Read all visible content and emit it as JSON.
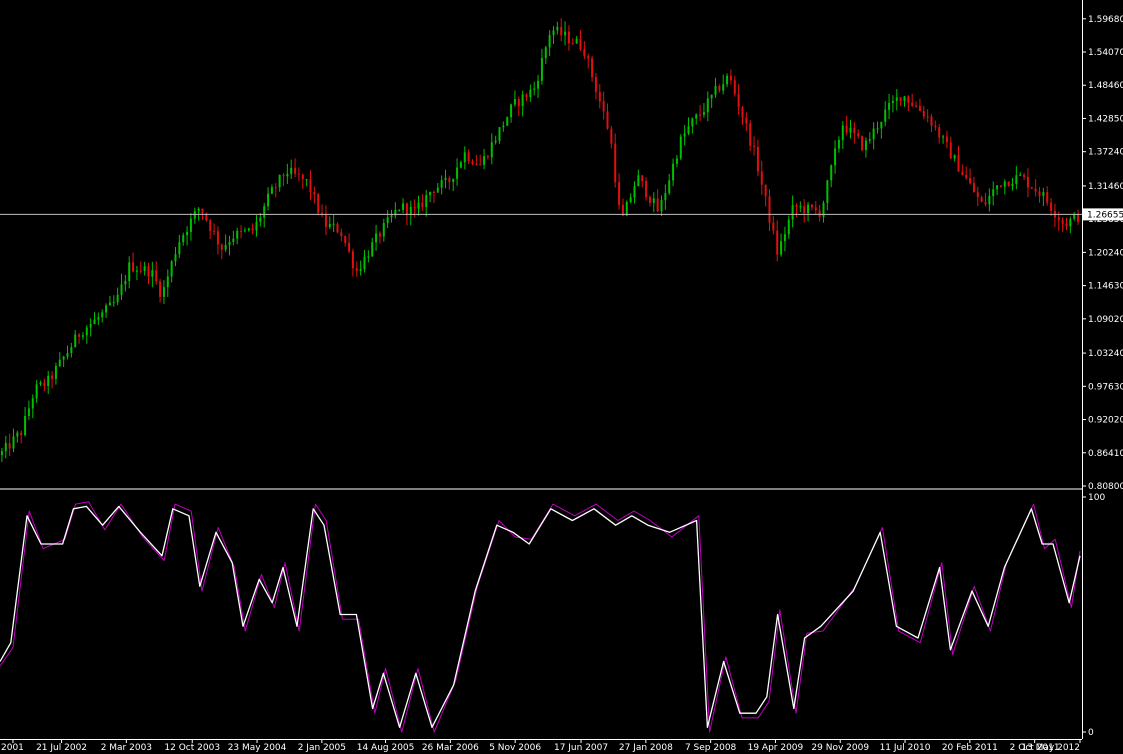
{
  "chart_data": [
    {
      "type": "candlestick",
      "panel": "price",
      "current_price": "1.26655",
      "current_price_value": 1.26655,
      "ylim": [
        0.808,
        1.615
      ],
      "y_ticks": [
        "1.59680",
        "1.54070",
        "1.48460",
        "1.42850",
        "1.37240",
        "1.31460",
        "1.25850",
        "1.20240",
        "1.14630",
        "1.09020",
        "1.03240",
        "0.97630",
        "0.92020",
        "0.86410",
        "0.80800"
      ],
      "y_tick_values": [
        1.5968,
        1.5407,
        1.4846,
        1.4285,
        1.3724,
        1.3146,
        1.2585,
        1.2024,
        1.1463,
        1.0902,
        1.0324,
        0.9763,
        0.9202,
        0.8641,
        0.808
      ],
      "colors": {
        "bull": "#00c000",
        "bear": "#e01010",
        "price_line": "#c0c0c0",
        "background": "#000000",
        "axis": "#ffffff"
      },
      "close_path": {
        "t": [
          0.0,
          0.02,
          0.032,
          0.045,
          0.075,
          0.09,
          0.108,
          0.12,
          0.14,
          0.15,
          0.165,
          0.185,
          0.205,
          0.215,
          0.235,
          0.25,
          0.265,
          0.285,
          0.3,
          0.315,
          0.33,
          0.35,
          0.37,
          0.385,
          0.4,
          0.415,
          0.43,
          0.445,
          0.475,
          0.495,
          0.51,
          0.54,
          0.565,
          0.575,
          0.59,
          0.61,
          0.63,
          0.64,
          0.65,
          0.665,
          0.675,
          0.69,
          0.7,
          0.72,
          0.735,
          0.76,
          0.78,
          0.8,
          0.82,
          0.835,
          0.86,
          0.88,
          0.91,
          0.925,
          0.945,
          0.965,
          0.985,
          1.0
        ],
        "close": [
          0.86,
          0.9,
          0.97,
          0.985,
          1.07,
          1.09,
          1.12,
          1.18,
          1.17,
          1.13,
          1.22,
          1.28,
          1.21,
          1.23,
          1.24,
          1.3,
          1.34,
          1.32,
          1.25,
          1.24,
          1.17,
          1.23,
          1.28,
          1.27,
          1.31,
          1.32,
          1.37,
          1.35,
          1.45,
          1.48,
          1.58,
          1.55,
          1.4,
          1.25,
          1.33,
          1.27,
          1.39,
          1.42,
          1.44,
          1.48,
          1.5,
          1.42,
          1.36,
          1.2,
          1.28,
          1.27,
          1.42,
          1.38,
          1.44,
          1.47,
          1.43,
          1.37,
          1.28,
          1.32,
          1.33,
          1.3,
          1.25,
          1.265
        ]
      }
    },
    {
      "type": "line",
      "panel": "oscillator",
      "ylim": [
        0,
        100
      ],
      "y_ticks": [
        "100",
        "0"
      ],
      "y_tick_values": [
        100,
        0
      ],
      "series": [
        {
          "color": "#ffffff",
          "t": [
            0.0,
            0.01,
            0.025,
            0.038,
            0.058,
            0.068,
            0.08,
            0.095,
            0.11,
            0.13,
            0.15,
            0.16,
            0.175,
            0.185,
            0.2,
            0.215,
            0.225,
            0.24,
            0.252,
            0.262,
            0.275,
            0.29,
            0.3,
            0.315,
            0.33,
            0.345,
            0.355,
            0.37,
            0.385,
            0.4,
            0.42,
            0.44,
            0.46,
            0.475,
            0.49,
            0.51,
            0.53,
            0.55,
            0.57,
            0.585,
            0.6,
            0.62,
            0.645,
            0.655,
            0.67,
            0.685,
            0.7,
            0.71,
            0.72,
            0.735,
            0.745,
            0.76,
            0.79,
            0.815,
            0.83,
            0.85,
            0.87,
            0.88,
            0.9,
            0.915,
            0.93,
            0.955,
            0.965,
            0.975,
            0.99,
            1.0
          ],
          "values": [
            30,
            38,
            92,
            80,
            80,
            95,
            96,
            88,
            96,
            85,
            75,
            95,
            92,
            62,
            85,
            72,
            45,
            65,
            55,
            70,
            45,
            95,
            88,
            50,
            50,
            10,
            25,
            2,
            25,
            2,
            20,
            60,
            88,
            85,
            80,
            95,
            90,
            95,
            88,
            92,
            88,
            85,
            90,
            2,
            30,
            8,
            8,
            15,
            50,
            10,
            40,
            45,
            60,
            85,
            45,
            40,
            70,
            35,
            60,
            45,
            70,
            95,
            80,
            80,
            55,
            75
          ]
        },
        {
          "color": "#c000c0",
          "t": [
            0.0,
            0.012,
            0.027,
            0.04,
            0.06,
            0.07,
            0.082,
            0.097,
            0.112,
            0.132,
            0.152,
            0.162,
            0.177,
            0.187,
            0.202,
            0.217,
            0.227,
            0.242,
            0.254,
            0.264,
            0.277,
            0.292,
            0.302,
            0.317,
            0.332,
            0.347,
            0.357,
            0.372,
            0.387,
            0.402,
            0.422,
            0.442,
            0.462,
            0.477,
            0.492,
            0.512,
            0.532,
            0.552,
            0.572,
            0.587,
            0.602,
            0.622,
            0.647,
            0.657,
            0.672,
            0.687,
            0.702,
            0.712,
            0.722,
            0.737,
            0.747,
            0.762,
            0.792,
            0.817,
            0.832,
            0.852,
            0.872,
            0.882,
            0.902,
            0.917,
            0.932,
            0.957,
            0.967,
            0.977,
            0.992,
            1.0
          ],
          "values": [
            28,
            36,
            94,
            78,
            82,
            97,
            98,
            86,
            97,
            83,
            73,
            97,
            94,
            60,
            87,
            70,
            43,
            67,
            53,
            72,
            43,
            97,
            90,
            48,
            48,
            8,
            27,
            0,
            27,
            0,
            22,
            62,
            90,
            83,
            82,
            97,
            92,
            97,
            90,
            94,
            90,
            83,
            92,
            0,
            32,
            6,
            6,
            13,
            52,
            8,
            42,
            43,
            62,
            87,
            43,
            38,
            72,
            33,
            62,
            43,
            72,
            97,
            78,
            82,
            53,
            77
          ]
        }
      ]
    },
    {
      "type": "time_axis",
      "labels": [
        "2001",
        "21 Jul 2002",
        "2 Mar 2003",
        "12 Oct 2003",
        "23 May 2004",
        "2 Jan 2005",
        "14 Aug 2005",
        "26 Mar 2006",
        "5 Nov 2006",
        "17 Jun 2007",
        "27 Jan 2008",
        "7 Sep 2008",
        "19 Apr 2009",
        "29 Nov 2009",
        "11 Jul 2010",
        "20 Feb 2011",
        "2 Oct 2011",
        "13 May 2012"
      ],
      "label_t": [
        0.012,
        0.057,
        0.117,
        0.178,
        0.238,
        0.298,
        0.357,
        0.417,
        0.477,
        0.538,
        0.598,
        0.658,
        0.718,
        0.778,
        0.838,
        0.898,
        0.958,
        1.0
      ]
    }
  ]
}
